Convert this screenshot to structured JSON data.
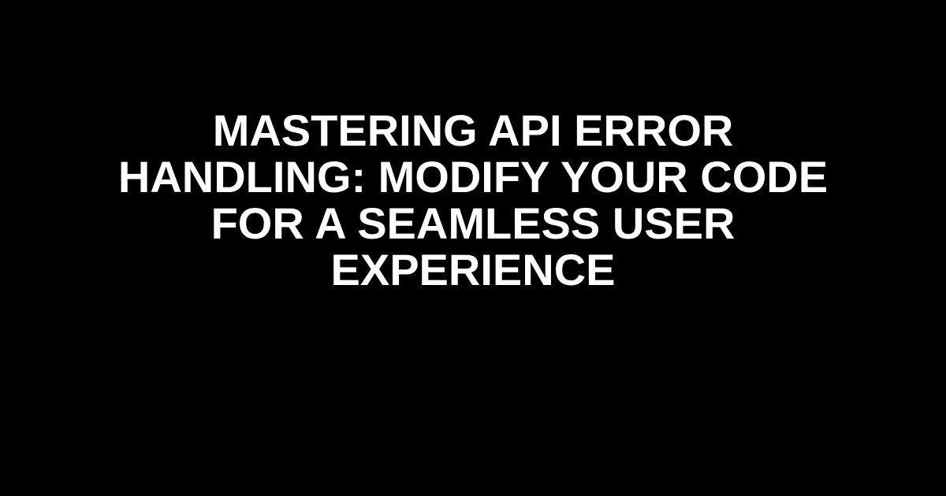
{
  "hero": {
    "title": "Mastering API Error Handling: Modify Your Code for a Seamless User Experience"
  },
  "colors": {
    "background": "#000000",
    "text": "#ffffff"
  }
}
